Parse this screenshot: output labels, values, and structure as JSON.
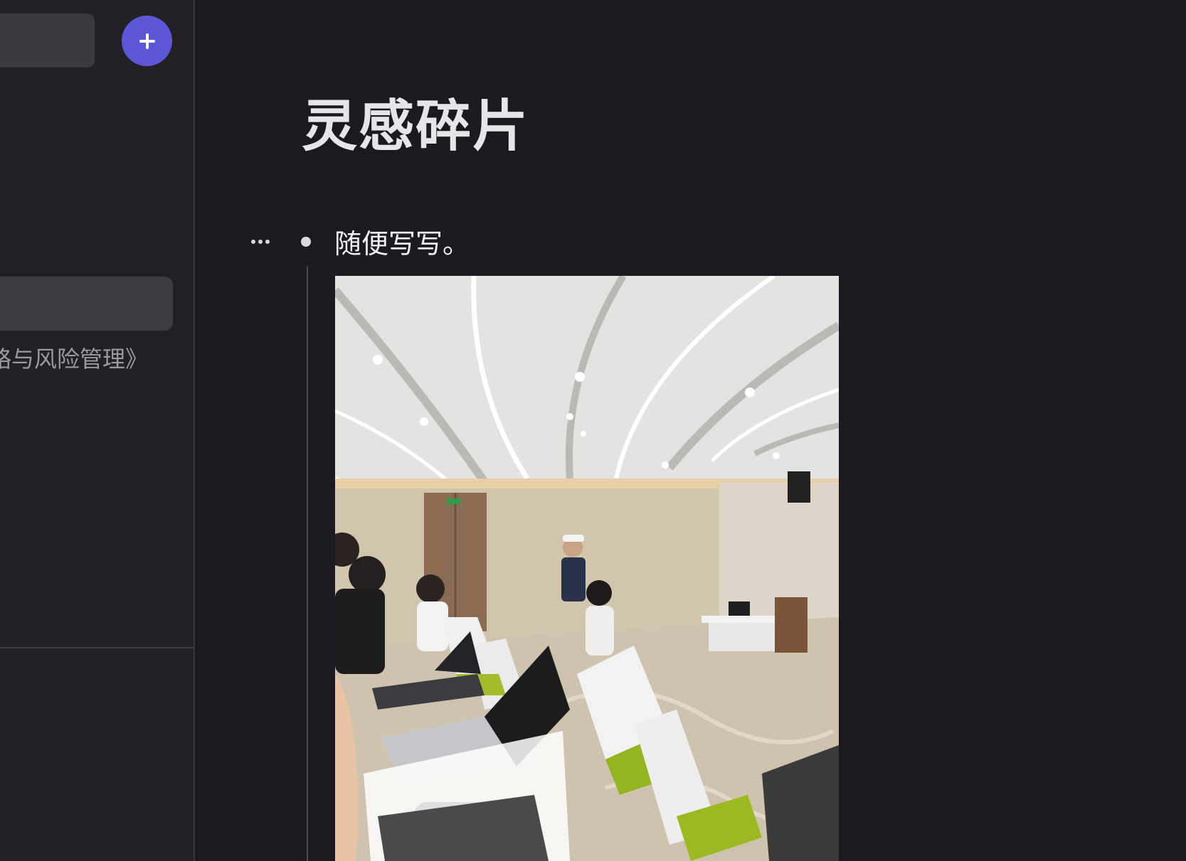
{
  "sidebar": {
    "add_button_icon": "plus-icon",
    "note_item_label": "略与风险管理》"
  },
  "page": {
    "title": "灵感碎片",
    "block_menu_icon": "more-horizontal-icon",
    "blocks": [
      {
        "text": "随便写写。"
      }
    ],
    "image": {
      "description_name": "classroom-photo"
    }
  },
  "colors": {
    "background": "#1c1a20",
    "sidebar": "#222026",
    "accent": "#5b57d6",
    "selected": "#3d3c42"
  }
}
